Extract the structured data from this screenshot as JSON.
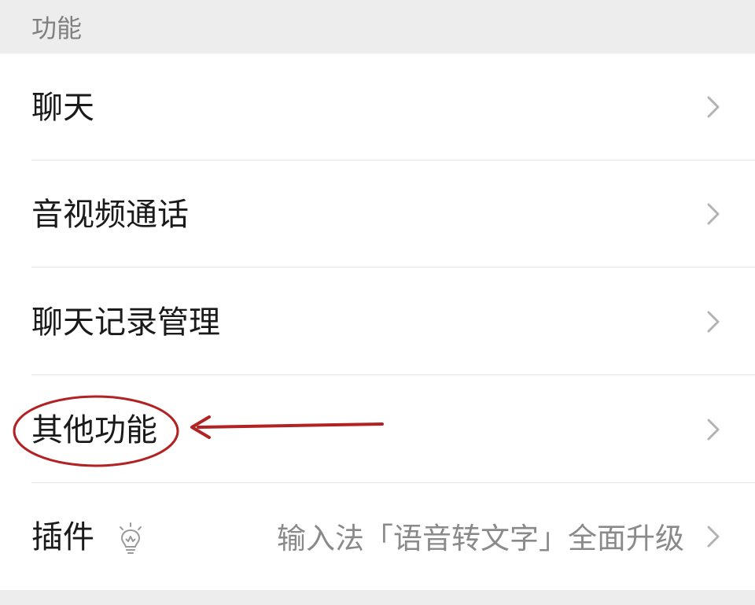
{
  "section": {
    "title": "功能"
  },
  "rows": [
    {
      "label": "聊天",
      "icon": "chevron-right-icon"
    },
    {
      "label": "音视频通话",
      "icon": "chevron-right-icon"
    },
    {
      "label": "聊天记录管理",
      "icon": "chevron-right-icon"
    },
    {
      "label": "其他功能",
      "icon": "chevron-right-icon"
    },
    {
      "label": "插件",
      "badge_icon": "lightbulb-icon",
      "value": "输入法「语音转文字」全面升级",
      "icon": "chevron-right-icon"
    }
  ],
  "annotation": {
    "color": "#b22222"
  },
  "colors": {
    "background": "#ededed",
    "list_background": "#ffffff",
    "label": "#1a1a1a",
    "secondary": "#8a8a8a",
    "chevron": "#b3b3b3",
    "divider": "#e6e6e6"
  }
}
